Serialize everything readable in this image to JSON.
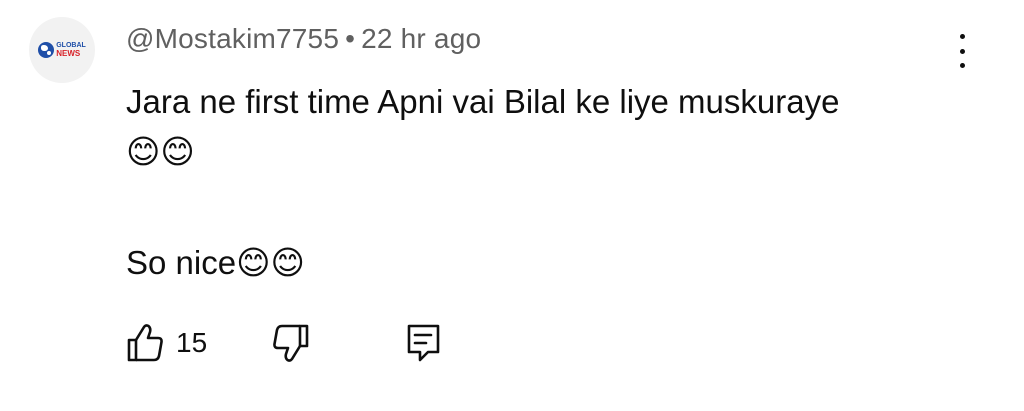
{
  "avatar": {
    "logo_line1": "GLOBAL",
    "logo_line2": "NEWS",
    "globe_color": "#1f4fa8",
    "accent_color": "#d8232a"
  },
  "comment": {
    "author": "@Mostakim7755",
    "separator": "•",
    "time": "22 hr ago",
    "line1": "Jara ne first time Apni vai Bilal ke liye muskuraye",
    "line2": "😊😊",
    "line3": "So nice😊😊"
  },
  "actions": {
    "like_icon": "thumb-up-icon",
    "like_count": "15",
    "dislike_icon": "thumb-down-icon",
    "reply_icon": "reply-comment-icon",
    "more_icon": "more-vertical-icon"
  }
}
